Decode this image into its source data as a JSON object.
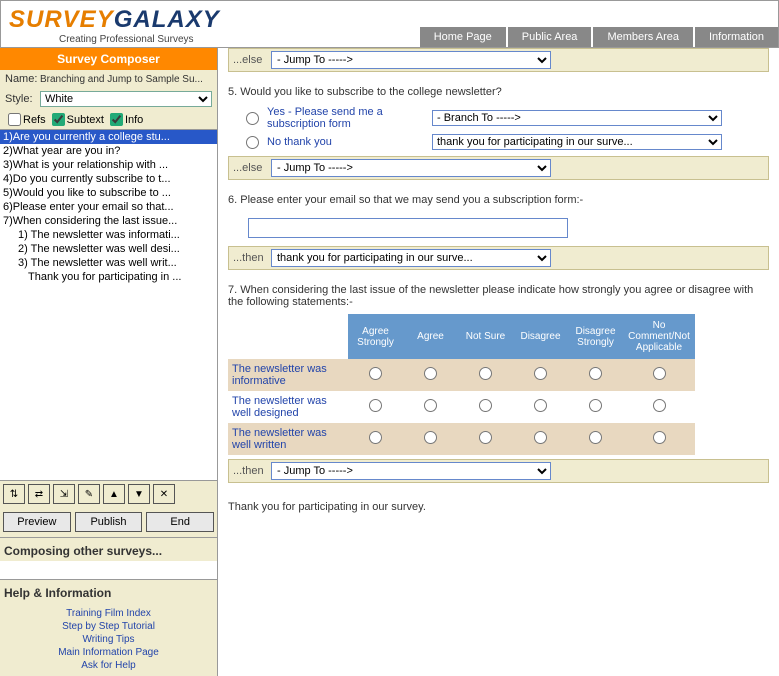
{
  "logo": {
    "brand1": "SURVEY",
    "brand2": "GALAXY",
    "tagline": "Creating Professional Surveys"
  },
  "nav": [
    "Home Page",
    "Public Area",
    "Members Area",
    "Information"
  ],
  "composer": {
    "title": "Survey Composer",
    "name_label": "Name:",
    "name_value": "Branching and Jump to Sample Su...",
    "style_label": "Style:",
    "style_value": "White",
    "refs": "Refs",
    "subtext": "Subtext",
    "info": "Info"
  },
  "questions": [
    "1)Are you currently a college stu...",
    "2)What year are you in?",
    "3)What is your relationship with ...",
    "4)Do you currently subscribe to t...",
    "5)Would you like to subscribe to ...",
    "6)Please enter your email so that...",
    "7)When considering the last issue..."
  ],
  "subitems": [
    "1) The newsletter was informati...",
    "2) The newsletter was well desi...",
    "3) The newsletter was well writ...",
    "Thank you for participating in ..."
  ],
  "toolbar_icons": [
    "⇅",
    "⇄",
    "⇲",
    "✎",
    "▲",
    "▼",
    "✕"
  ],
  "actions": {
    "preview": "Preview",
    "publish": "Publish",
    "end": "End"
  },
  "other_surveys": "Composing other surveys...",
  "help_title": "Help & Information",
  "help_links": [
    "Training Film Index",
    "Step by Step Tutorial",
    "Writing Tips",
    "Main Information Page",
    "Ask for Help"
  ],
  "top_else": {
    "label": "...else",
    "value": "- Jump To ----->"
  },
  "q5": {
    "text": "5. Would you like to subscribe to the college newsletter?",
    "opt1": "Yes - Please send me a subscription form",
    "opt1_jump": "- Branch To ----->",
    "opt2": "No thank you",
    "opt2_jump": "thank you for participating in our surve...",
    "else_label": "...else",
    "else_value": "- Jump To ----->"
  },
  "q6": {
    "text": "6. Please enter your email so that we may send you a subscription form:-",
    "then_label": "...then",
    "then_value": "thank you for participating in our surve..."
  },
  "q7": {
    "text": "7. When considering the last issue of the newsletter please indicate how strongly you agree or disagree with the following statements:-",
    "cols": [
      "Agree Strongly",
      "Agree",
      "Not Sure",
      "Disagree",
      "Disagree Strongly",
      "No Comment/Not Applicable"
    ],
    "rows": [
      "The newsletter was informative",
      "The newsletter was well designed",
      "The newsletter was well written"
    ],
    "then_label": "...then",
    "then_value": "- Jump To ----->"
  },
  "thanks": "Thank you for participating in our survey."
}
